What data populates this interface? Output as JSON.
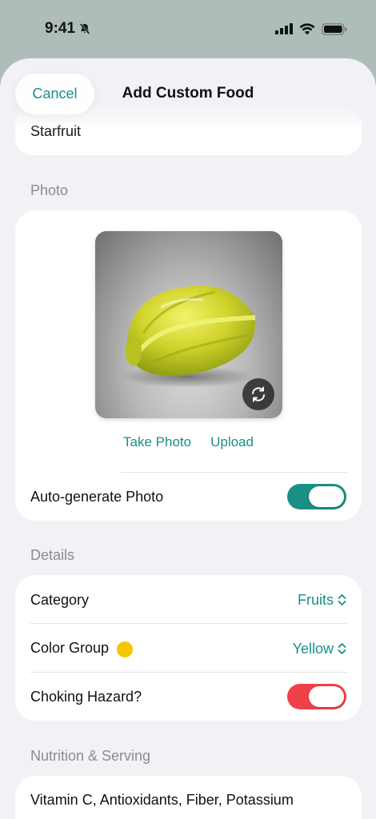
{
  "status_bar": {
    "time": "9:41"
  },
  "nav": {
    "cancel_label": "Cancel",
    "title": "Add Custom Food"
  },
  "name_field": {
    "value": "Starfruit"
  },
  "photo_section": {
    "header": "Photo",
    "take_photo_label": "Take Photo",
    "upload_label": "Upload",
    "auto_generate_label": "Auto-generate Photo",
    "auto_generate_on": true
  },
  "details_section": {
    "header": "Details",
    "category_label": "Category",
    "category_value": "Fruits",
    "color_group_label": "Color Group",
    "color_group_value": "Yellow",
    "color_group_swatch": "#f6c500",
    "choking_label": "Choking Hazard?",
    "choking_on": true
  },
  "nutrition_section": {
    "header": "Nutrition & Serving",
    "nutrients_value": "Vitamin C, Antioxidants, Fiber, Potassium"
  },
  "colors": {
    "accent": "#1a8f86",
    "toggle_green": "#1a8f86",
    "toggle_red": "#f0414b"
  }
}
